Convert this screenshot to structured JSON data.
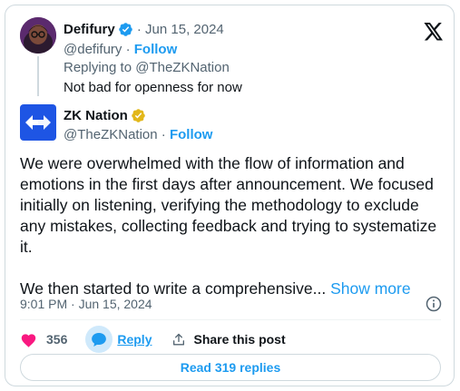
{
  "parent_tweet": {
    "author_name": "Defifury",
    "date": "Jun 15, 2024",
    "handle": "@defifury",
    "follow_label": "Follow",
    "replying_to_prefix": "Replying to",
    "replying_to_handle": "@TheZKNation",
    "text": "Not bad for openness for now"
  },
  "main_tweet": {
    "author_name": "ZK Nation",
    "handle": "@TheZKNation",
    "follow_label": "Follow",
    "paragraphs": [
      "We were overwhelmed with the flow of information and emotions in the first days after announcement. We focused initially on listening, verifying the methodology to exclude any mistakes, collecting feedback and trying to systematize it.",
      "We then started to write a comprehensive..."
    ],
    "show_more_label": "Show more",
    "timestamp": "9:01 PM · Jun 15, 2024"
  },
  "actions": {
    "like_count": "356",
    "reply_label": "Reply",
    "share_label": "Share this post"
  },
  "read_replies_label": "Read 319 replies",
  "icons": {
    "verified": "verified-badge-icon",
    "verified_gold": "gold-verified-badge-icon",
    "logo": "x-logo-icon",
    "info": "info-icon",
    "like": "heart-icon",
    "reply": "reply-bubble-icon",
    "share": "share-icon"
  },
  "colors": {
    "accent": "#1d9bf0",
    "like": "#f91880",
    "text": "#0f1419",
    "muted": "#536471",
    "gold": "#e2b719",
    "zk_blue": "#1e55e4"
  }
}
